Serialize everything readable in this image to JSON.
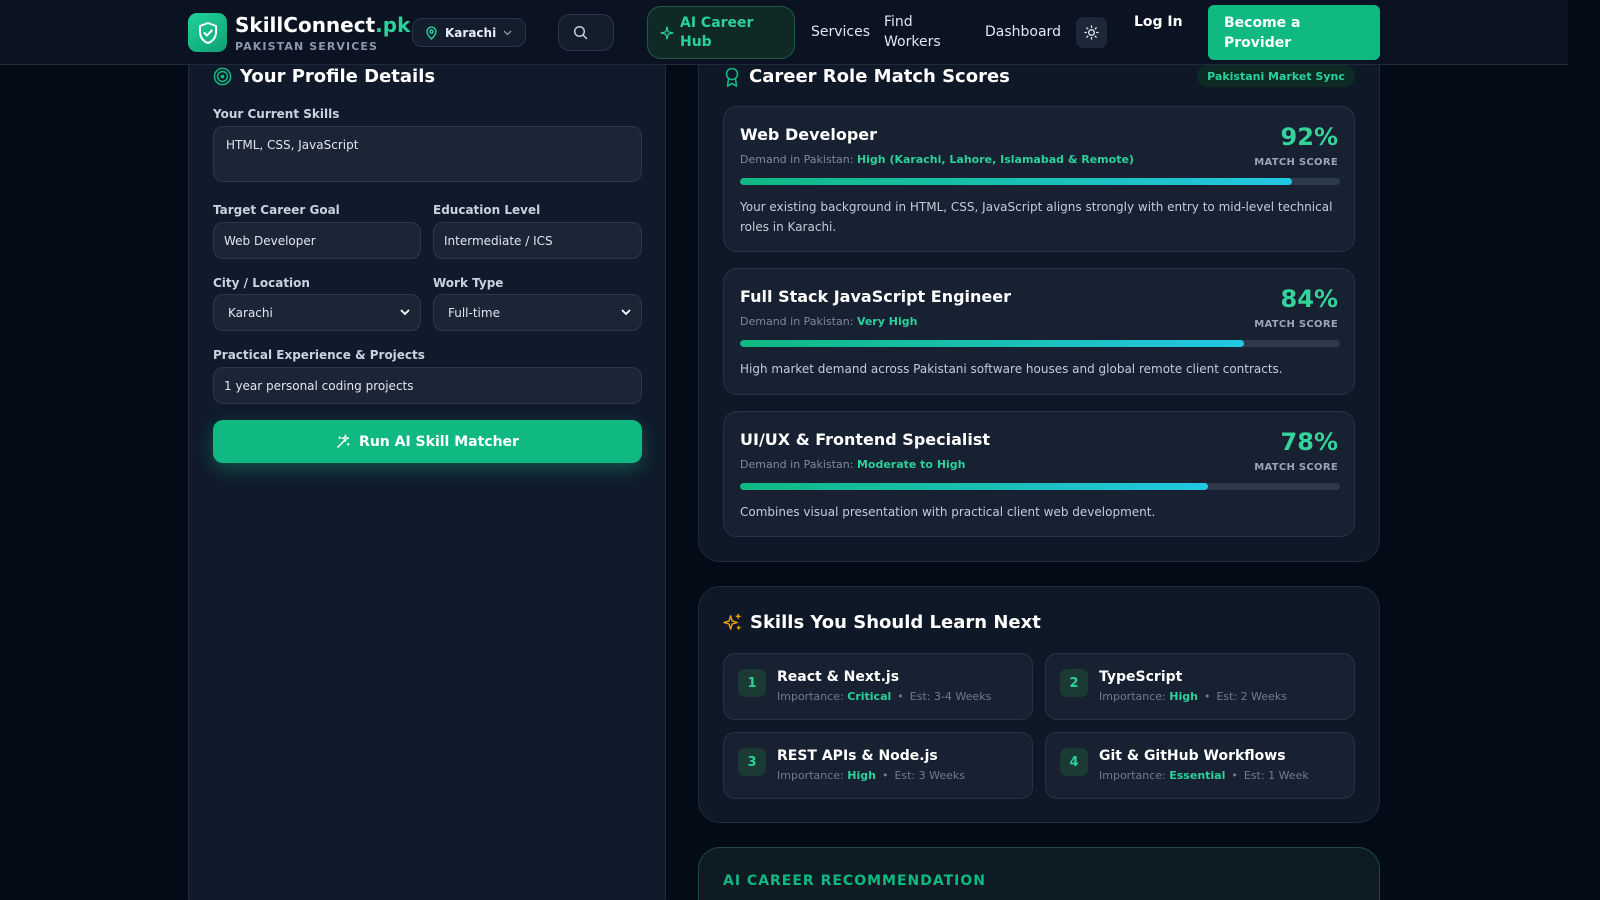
{
  "header": {
    "brand_name": "SkillConnect",
    "brand_tld": ".pk",
    "brand_sub": "PAKISTAN SERVICES",
    "location": "Karachi",
    "hub_label": "AI Career Hub",
    "nav": {
      "services": "Services",
      "find_workers": "Find Workers",
      "dashboard": "Dashboard"
    },
    "login": "Log In",
    "cta": "Become a Provider"
  },
  "profile": {
    "title": "Your Profile Details",
    "skills_label": "Your Current Skills",
    "skills_value": "HTML, CSS, JavaScript",
    "goal_label": "Target Career Goal",
    "goal_value": "Web Developer",
    "education_label": "Education Level",
    "education_value": "Intermediate / ICS",
    "city_label": "City / Location",
    "city_value": "Karachi",
    "worktype_label": "Work Type",
    "worktype_value": "Full-time",
    "experience_label": "Practical Experience & Projects",
    "experience_value": "1 year personal coding projects",
    "run_button": "Run AI Skill Matcher"
  },
  "matches": {
    "title": "Career Role Match Scores",
    "badge": "Pakistani Market Sync",
    "demand_prefix": "Demand in Pakistan:",
    "score_label": "MATCH SCORE",
    "roles": [
      {
        "title": "Web Developer",
        "demand": "High (Karachi, Lahore, Islamabad & Remote)",
        "score": "92%",
        "fill": 0.92,
        "desc": "Your existing background in HTML, CSS, JavaScript aligns strongly with entry to mid-level technical roles in Karachi."
      },
      {
        "title": "Full Stack JavaScript Engineer",
        "demand": "Very High",
        "score": "84%",
        "fill": 0.84,
        "desc": "High market demand across Pakistani software houses and global remote client contracts."
      },
      {
        "title": "UI/UX & Frontend Specialist",
        "demand": "Moderate to High",
        "score": "78%",
        "fill": 0.78,
        "desc": "Combines visual presentation with practical client web development."
      }
    ]
  },
  "learn": {
    "title": "Skills You Should Learn Next",
    "importance_prefix": "Importance:",
    "skills": [
      {
        "num": "1",
        "title": "React & Next.js",
        "importance": "Critical",
        "est": "Est: 3-4 Weeks"
      },
      {
        "num": "2",
        "title": "TypeScript",
        "importance": "High",
        "est": "Est: 2 Weeks"
      },
      {
        "num": "3",
        "title": "REST APIs & Node.js",
        "importance": "High",
        "est": "Est: 3 Weeks"
      },
      {
        "num": "4",
        "title": "Git & GitHub Workflows",
        "importance": "Essential",
        "est": "Est: 1 Week"
      }
    ]
  },
  "recommendation": {
    "label": "AI CAREER RECOMMENDATION"
  },
  "colors": {
    "accent": "#10b981",
    "accent_text": "#2bd19a",
    "background": "#030b17",
    "panel": "#101a2a"
  }
}
